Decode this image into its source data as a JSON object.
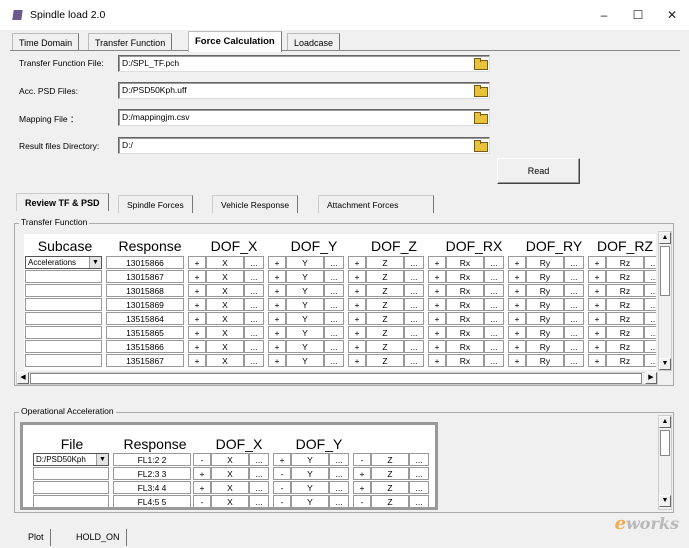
{
  "window": {
    "title": "Spindle load 2.0",
    "minimize": "–",
    "maximize": "☐",
    "close": "✕"
  },
  "tabs": [
    "Time Domain",
    "Transfer Function",
    "Force Calculation",
    "Loadcase"
  ],
  "form": {
    "transfer_label": "Transfer Function File:",
    "transfer_value": "D:/SPL_TF.pch",
    "psd_label": "Acc. PSD Files:",
    "psd_value": "D:/PSD50Kph.uff",
    "mapping_label": "Mapping File ：",
    "mapping_value": "D:/mappingjm.csv",
    "result_label": "Result files Directory:",
    "result_value": "D:/",
    "read_button": "Read"
  },
  "subtabs": [
    "Review TF & PSD",
    "Spindle Forces",
    "Vehicle Response",
    "Attachment Forces"
  ],
  "tf": {
    "group_label": "Transfer Function",
    "headers": [
      "Subcase",
      "Response",
      "DOF_X",
      "DOF_Y",
      "DOF_Z",
      "DOF_RX",
      "DOF_RY",
      "DOF_RZ"
    ],
    "subcase_value": "Accelerations",
    "responses": [
      "13015866",
      "13015867",
      "13015868",
      "13015869",
      "13515864",
      "13515865",
      "13515866",
      "13515867"
    ],
    "dof_labels": [
      "X",
      "Y",
      "Z",
      "Rx",
      "Ry",
      "Rz"
    ],
    "plus": "+",
    "ellipsis": "..."
  },
  "oa": {
    "group_label": "Operational Acceleration",
    "headers": [
      "File",
      "Response",
      "DOF_X",
      "DOF_Y"
    ],
    "file_value": "D:/PSD50Kph",
    "rows": [
      {
        "response": "FL1:2 2",
        "signs": [
          "-",
          "+",
          "-"
        ]
      },
      {
        "response": "FL2:3 3",
        "signs": [
          "+",
          "-",
          "+"
        ]
      },
      {
        "response": "FL3:4 4",
        "signs": [
          "+",
          "-",
          "+"
        ]
      },
      {
        "response": "FL4:5 5",
        "signs": [
          "-",
          "-",
          "-"
        ]
      }
    ],
    "dof_labels": [
      "X",
      "Y",
      "Z"
    ],
    "ellipsis": "..."
  },
  "bottom_tabs": [
    "Plot",
    "HOLD_ON"
  ],
  "watermark": {
    "prefix": "e",
    "text": "works"
  }
}
